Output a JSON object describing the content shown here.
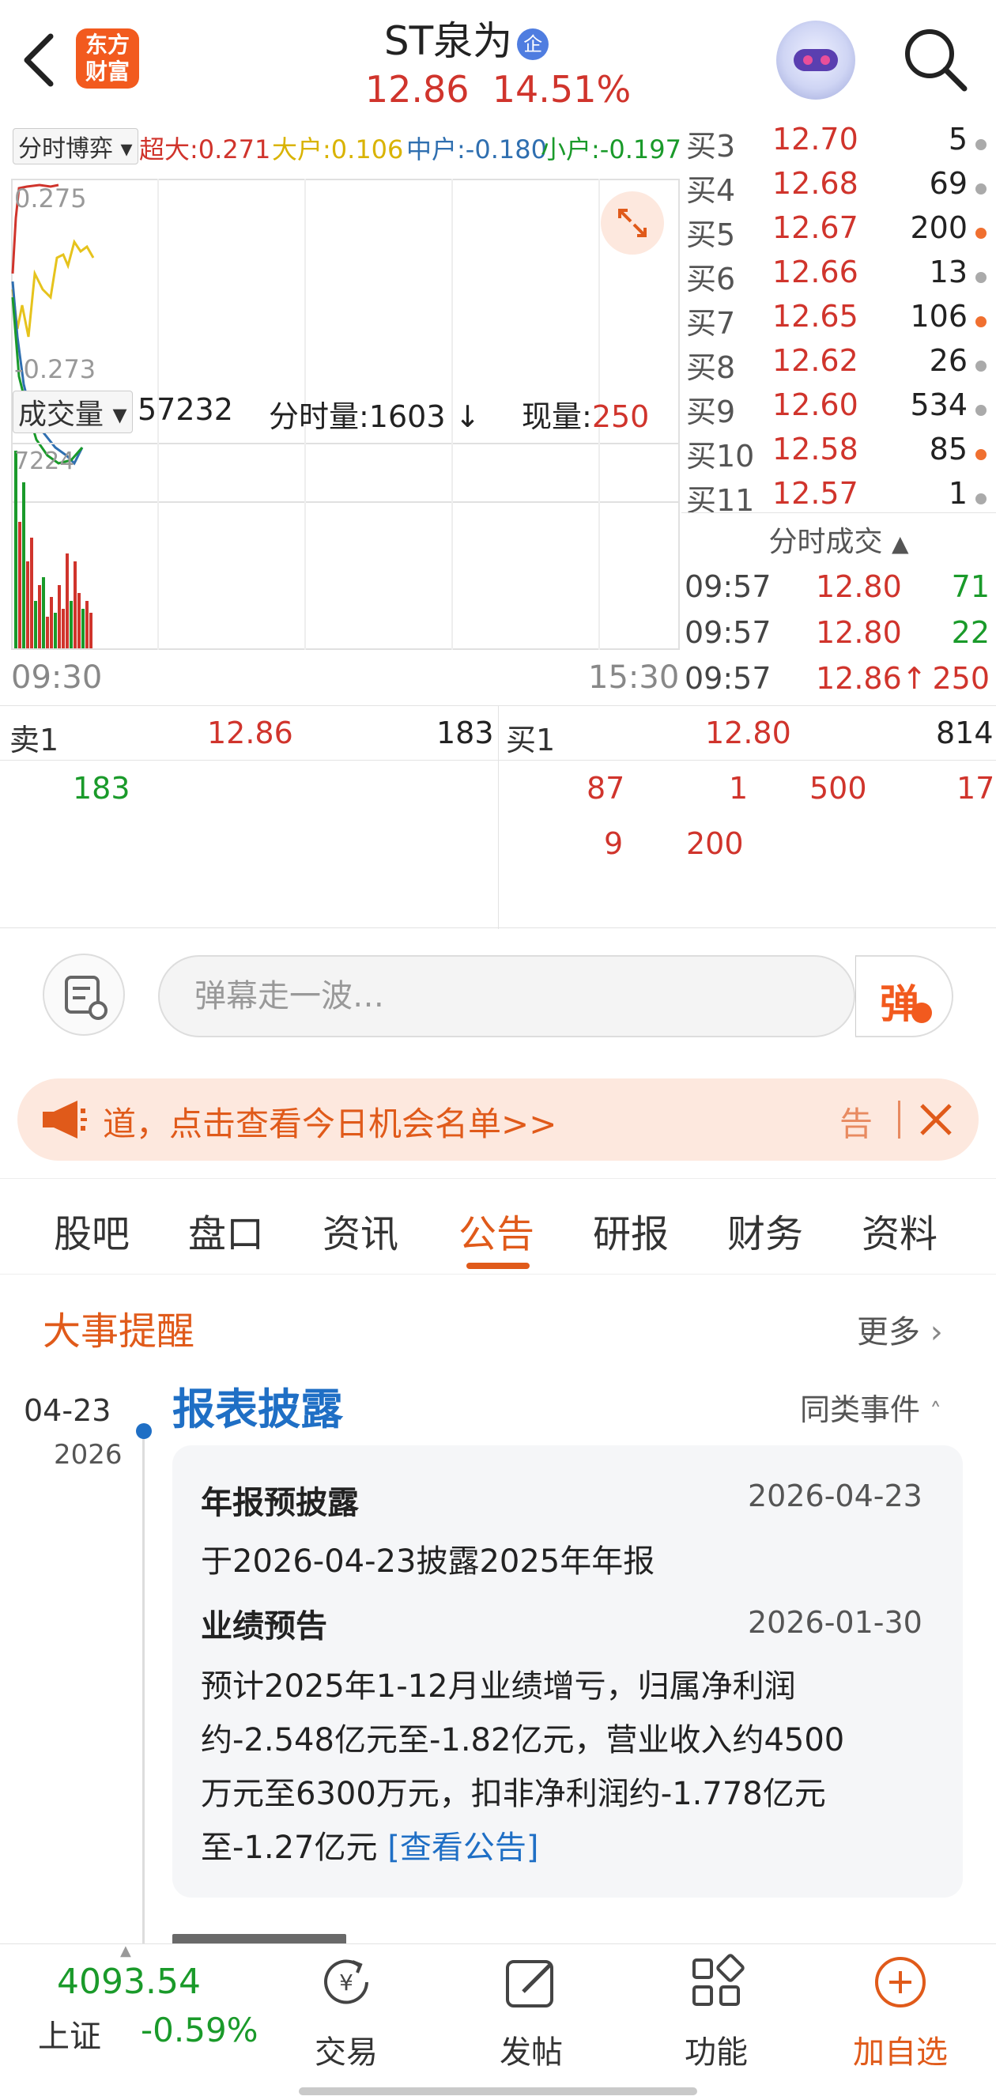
{
  "header": {
    "logo_line1": "东方",
    "logo_line2": "财富",
    "stock_name": "ST泉为",
    "badge": "企",
    "price": "12.86",
    "change_pct": "14.51%"
  },
  "chart": {
    "tab_label": "分时博弈",
    "super_big": "超大:0.271",
    "big": "大户:0.106",
    "mid": "中户:-0.180",
    "small": "小户:-0.197",
    "y_top": "0.275",
    "y_bottom": "-0.273",
    "volume_label": "成交量",
    "volume_total": "57232",
    "minute_volume": "分时量:1603 ↓",
    "current_volume_label": "现量:",
    "current_volume": "250",
    "vol_axis_max": "7224",
    "time_start": "09:30",
    "time_end": "15:30",
    "series_colors": {
      "super_big": "#d0342c",
      "big": "#e6c31c",
      "mid": "#2f6fb0",
      "small": "#1a9a2a"
    }
  },
  "bids": [
    {
      "label": "买3",
      "price": "12.70",
      "volume": "5",
      "dot": "gray"
    },
    {
      "label": "买4",
      "price": "12.68",
      "volume": "69",
      "dot": "gray"
    },
    {
      "label": "买5",
      "price": "12.67",
      "volume": "200",
      "dot": "orange"
    },
    {
      "label": "买6",
      "price": "12.66",
      "volume": "13",
      "dot": "gray"
    },
    {
      "label": "买7",
      "price": "12.65",
      "volume": "106",
      "dot": "orange"
    },
    {
      "label": "买8",
      "price": "12.62",
      "volume": "26",
      "dot": "gray"
    },
    {
      "label": "买9",
      "price": "12.60",
      "volume": "534",
      "dot": "gray"
    },
    {
      "label": "买10",
      "price": "12.58",
      "volume": "85",
      "dot": "orange"
    },
    {
      "label": "买11",
      "price": "12.57",
      "volume": "1",
      "dot": "gray"
    }
  ],
  "fenshi_title": "分时成交",
  "trades": [
    {
      "time": "09:57",
      "price": "12.80",
      "volume": "71",
      "color": "green"
    },
    {
      "time": "09:57",
      "price": "12.80",
      "volume": "22",
      "color": "green"
    },
    {
      "time": "09:57",
      "price": "12.86↑",
      "volume": "250",
      "color": "red"
    }
  ],
  "orderbook": {
    "sell_label": "卖1",
    "sell_price": "12.86",
    "sell_volume": "183",
    "sell_detail": "183",
    "buy_label": "买1",
    "buy_price": "12.80",
    "buy_volume": "814",
    "buy_detail_row1": [
      "87",
      "1",
      "500",
      "17"
    ],
    "buy_detail_row2": [
      "9",
      "200"
    ]
  },
  "danmaku": {
    "placeholder": "弹幕走一波…",
    "send_label": "弹"
  },
  "banner": {
    "text": "道，点击查看今日机会名单>>",
    "right_text": "告"
  },
  "tabs": [
    "股吧",
    "盘口",
    "资讯",
    "公告",
    "研报",
    "财务",
    "资料"
  ],
  "active_tab": "公告",
  "events": {
    "title": "大事提醒",
    "more": "更多",
    "date": "04-23",
    "year": "2026",
    "category": "报表披露",
    "same_events": "同类事件",
    "item1_title": "年报预披露",
    "item1_date": "2026-04-23",
    "item1_text": "于2026-04-23披露2025年年报",
    "item2_title": "业绩预告",
    "item2_date": "2026-01-30",
    "item2_line1": "预计2025年1-12月业绩增亏，归属净利润",
    "item2_line2": "约-2.548亿元至-1.82亿元，营业收入约4500",
    "item2_line3": "万元至6300万元，扣非净利润约-1.778亿元",
    "item2_line4": "至-1.27亿元",
    "view_link": "[查看公告]"
  },
  "bottom": {
    "index_value": "4093.54",
    "index_name": "上证",
    "index_change": "-0.59%",
    "trade": "交易",
    "post": "发帖",
    "function": "功能",
    "add_watch": "加自选"
  }
}
